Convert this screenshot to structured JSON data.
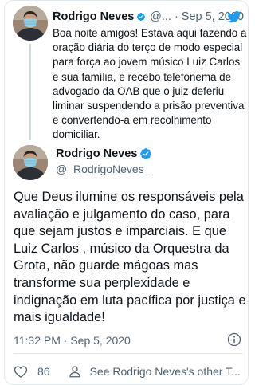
{
  "parent_tweet": {
    "name": "Rodrigo Neves",
    "handle_truncated": "@...",
    "separator": "·",
    "date": "Sep 5, 2020",
    "text": "Boa noite amigos! Estava aqui fazendo a oração diária do terço de modo especial para força ao jovem músico Luiz Carlos e sua família, e recebo telefonema de advogado da OAB que o juiz deferiu liminar suspendendo a prisão preventiva e convertendo-a em recolhimento domiciliar."
  },
  "main_tweet": {
    "name": "Rodrigo Neves",
    "handle": "@_RodrigoNeves_",
    "text": "Que Deus ilumine os responsáveis pela avaliação e julgamento do caso, para que sejam justos e imparciais. E que Luiz Carlos , músico da Orquestra da Grota, não guarde mágoas mas transforme sua perplexidade e indignação em luta pacífica por justiça e mais igualdade!",
    "timestamp": "11:32 PM · Sep 5, 2020",
    "like_count": "86",
    "see_more_label": "See Rodrigo Neves's other T..."
  },
  "colors": {
    "twitter_blue": "#1d9bf0",
    "secondary_text": "#536471",
    "primary_text": "#0f1419",
    "heart_red": "#e0245e"
  },
  "icons": [
    "avatar",
    "verified-badge-icon",
    "twitter-bird-icon",
    "info-icon",
    "heart-icon",
    "user-icon"
  ]
}
